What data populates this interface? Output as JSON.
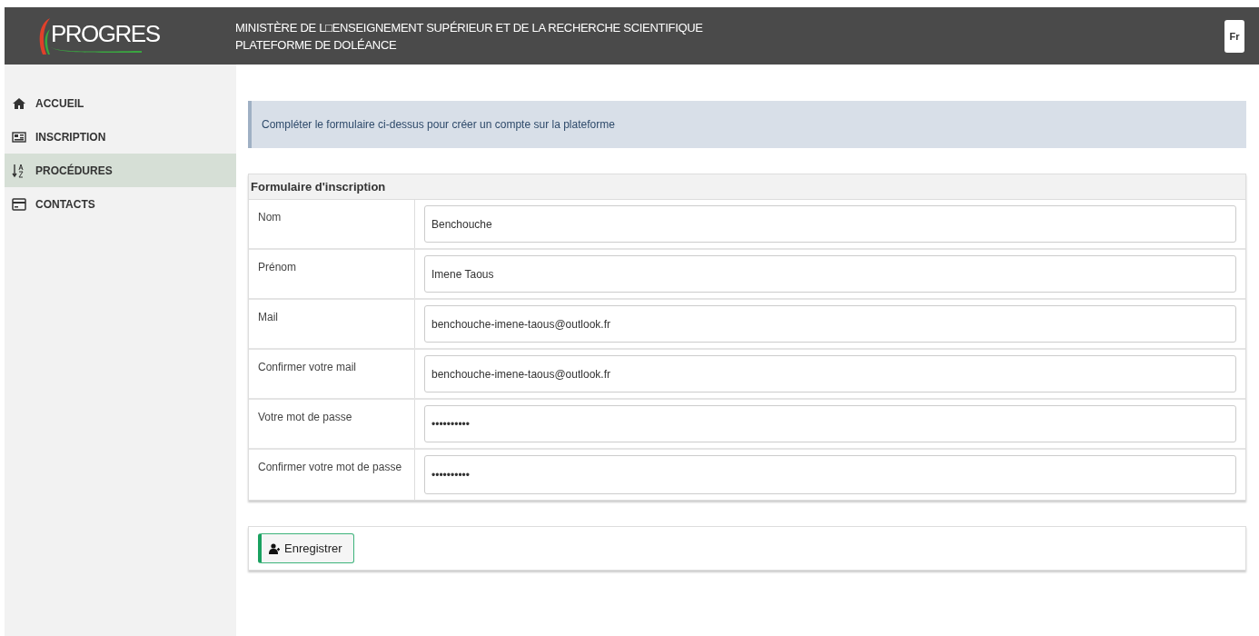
{
  "header": {
    "logo": "PROGRES",
    "title_line_1": "MINISTÈRE DE L□ENSEIGNEMENT SUPÉRIEUR ET DE LA RECHERCHE SCIENTIFIQUE",
    "title_line_2": "PLATEFORME DE DOLÉANCE",
    "language": "Fr"
  },
  "sidebar": {
    "items": [
      {
        "label": "ACCUEIL",
        "kind": "home",
        "selected": false
      },
      {
        "label": "INSCRIPTION",
        "kind": "card",
        "selected": false
      },
      {
        "label": "PROCÉDURES",
        "kind": "sort",
        "selected": true
      },
      {
        "label": "CONTACTS",
        "kind": "contact",
        "selected": false
      }
    ]
  },
  "notice": "Compléter le formulaire ci-dessus pour créer un compte sur la plateforme",
  "form": {
    "title": "Formulaire d'inscription",
    "fields": [
      {
        "label": "Nom",
        "value": "Benchouche"
      },
      {
        "label": "Prénom",
        "value": "Imene Taous"
      },
      {
        "label": "Mail",
        "value": "benchouche-imene-taous@outlook.fr"
      },
      {
        "label": "Confirmer votre mail",
        "value": "benchouche-imene-taous@outlook.fr"
      },
      {
        "label": "Votre mot de passe",
        "value": "••••••••••"
      },
      {
        "label": "Confirmer votre mot de passe",
        "value": "••••••••••"
      }
    ]
  },
  "submit_button": "Enregistrer"
}
